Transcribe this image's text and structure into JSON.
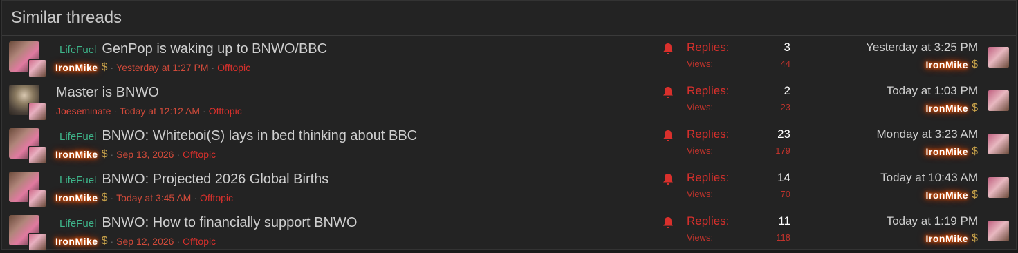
{
  "block": {
    "title": "Similar threads"
  },
  "threads": [
    {
      "prefix": "LifeFuel",
      "title": "GenPop is waking up to BNWO/BBC",
      "author": "IronMike",
      "started": "Yesterday at 1:27 PM",
      "forum": "Offtopic",
      "replies_label": "Replies:",
      "replies": "3",
      "views_label": "Views:",
      "views": "44",
      "last_time": "Yesterday at 3:25 PM",
      "last_user": "IronMike"
    },
    {
      "prefix": "",
      "title": "Master is BNWO",
      "author": "Joeseminate",
      "started": "Today at 12:12 AM",
      "forum": "Offtopic",
      "replies_label": "Replies:",
      "replies": "2",
      "views_label": "Views:",
      "views": "23",
      "last_time": "Today at 1:03 PM",
      "last_user": "IronMike"
    },
    {
      "prefix": "LifeFuel",
      "title": "BNWO: Whiteboi(S) lays in bed thinking about BBC",
      "author": "IronMike",
      "started": "Sep 13, 2026",
      "forum": "Offtopic",
      "replies_label": "Replies:",
      "replies": "23",
      "views_label": "Views:",
      "views": "179",
      "last_time": "Monday at 3:23 AM",
      "last_user": "IronMike"
    },
    {
      "prefix": "LifeFuel",
      "title": "BNWO: Projected 2026 Global Births",
      "author": "IronMike",
      "started": "Today at 3:45 AM",
      "forum": "Offtopic",
      "replies_label": "Replies:",
      "replies": "14",
      "views_label": "Views:",
      "views": "70",
      "last_time": "Today at 10:43 AM",
      "last_user": "IronMike"
    },
    {
      "prefix": "LifeFuel",
      "title": "BNWO: How to financially support BNWO",
      "author": "IronMike",
      "started": "Sep 12, 2026",
      "forum": "Offtopic",
      "replies_label": "Replies:",
      "replies": "11",
      "views_label": "Views:",
      "views": "118",
      "last_time": "Today at 1:19 PM",
      "last_user": "IronMike"
    }
  ],
  "icons": {
    "watch": "bell-icon",
    "donor": "dollar-icon"
  },
  "colors": {
    "accent_red": "#d9302c",
    "prefix_green": "#3eb58a",
    "glow_orange": "#ff5a00"
  }
}
